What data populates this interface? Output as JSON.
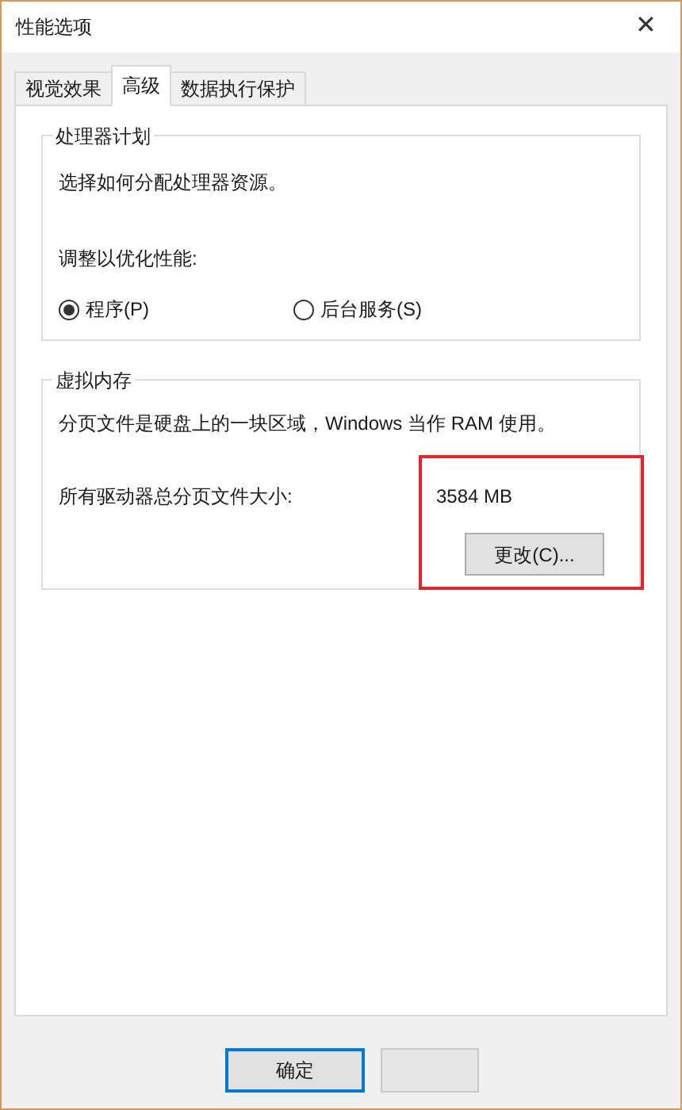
{
  "window": {
    "title": "性能选项",
    "close": "✕"
  },
  "tabs": [
    {
      "label": "视觉效果",
      "selected": false
    },
    {
      "label": "高级",
      "selected": true
    },
    {
      "label": "数据执行保护",
      "selected": false
    }
  ],
  "processor_group": {
    "title": "处理器计划",
    "description": "选择如何分配处理器资源。",
    "prompt": "调整以优化性能:",
    "options": [
      {
        "label": "程序(P)",
        "selected": true
      },
      {
        "label": "后台服务(S)",
        "selected": false
      }
    ]
  },
  "virtual_memory_group": {
    "title": "虚拟内存",
    "description": "分页文件是硬盘上的一块区域，Windows 当作 RAM 使用。",
    "size_label": "所有驱动器总分页文件大小:",
    "size_value": "3584 MB",
    "change_button": "更改(C)..."
  },
  "buttons": [
    {
      "label": "确定",
      "default": true
    },
    {
      "default": false
    }
  ]
}
